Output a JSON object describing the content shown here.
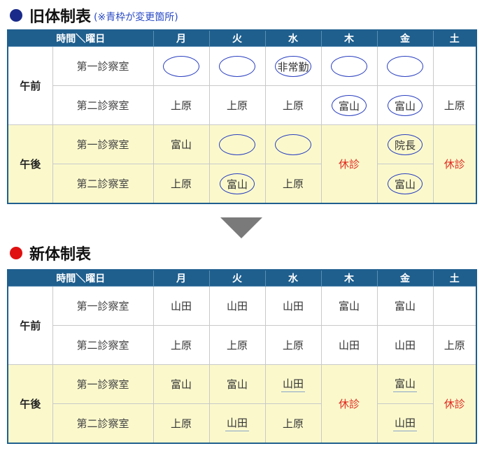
{
  "old": {
    "title": "旧体制表",
    "note": "(※青枠が変更箇所)",
    "dot_color": "#1a2a8a"
  },
  "new": {
    "title": "新体制表",
    "dot_color": "#e01010"
  },
  "header": {
    "corner": "時間＼曜日",
    "days": [
      "月",
      "火",
      "水",
      "木",
      "金",
      "土"
    ]
  },
  "periods": {
    "am": "午前",
    "pm": "午後"
  },
  "rooms": {
    "first": "第一診察室",
    "second": "第二診察室"
  },
  "closed_label": "休診",
  "old_table": {
    "am_first": [
      {
        "text": "",
        "oval": true
      },
      {
        "text": "",
        "oval": true
      },
      {
        "text": "非常勤",
        "oval": true
      },
      {
        "text": "",
        "oval": true
      },
      {
        "text": "",
        "oval": true
      },
      {
        "text": ""
      }
    ],
    "am_second": [
      {
        "text": "上原"
      },
      {
        "text": "上原"
      },
      {
        "text": "上原"
      },
      {
        "text": "富山",
        "oval": true
      },
      {
        "text": "富山",
        "oval": true
      },
      {
        "text": "上原"
      }
    ],
    "pm_first": [
      {
        "text": "富山"
      },
      {
        "text": "",
        "oval": true
      },
      {
        "text": "",
        "oval": true
      },
      null,
      {
        "text": "院長",
        "oval": true
      },
      null
    ],
    "pm_second": [
      {
        "text": "上原"
      },
      {
        "text": "富山",
        "oval": true
      },
      {
        "text": "上原"
      },
      null,
      {
        "text": "富山",
        "oval": true
      },
      null
    ]
  },
  "new_table": {
    "am_first": [
      {
        "text": "山田"
      },
      {
        "text": "山田"
      },
      {
        "text": "山田"
      },
      {
        "text": "富山"
      },
      {
        "text": "富山"
      },
      {
        "text": ""
      }
    ],
    "am_second": [
      {
        "text": "上原"
      },
      {
        "text": "上原"
      },
      {
        "text": "上原"
      },
      {
        "text": "山田"
      },
      {
        "text": "山田"
      },
      {
        "text": "上原"
      }
    ],
    "pm_first": [
      {
        "text": "富山"
      },
      {
        "text": "富山"
      },
      {
        "text": "山田",
        "underline": true
      },
      null,
      {
        "text": "富山",
        "underline": true
      },
      null
    ],
    "pm_second": [
      {
        "text": "上原"
      },
      {
        "text": "山田",
        "underline": true
      },
      {
        "text": "上原"
      },
      null,
      {
        "text": "山田",
        "underline": true
      },
      null
    ]
  }
}
